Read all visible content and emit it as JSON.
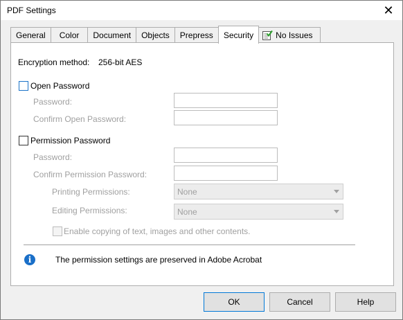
{
  "window": {
    "title": "PDF Settings"
  },
  "tabs": [
    {
      "label": "General"
    },
    {
      "label": "Color"
    },
    {
      "label": "Document"
    },
    {
      "label": "Objects"
    },
    {
      "label": "Prepress"
    },
    {
      "label": "Security"
    },
    {
      "label": "No Issues"
    }
  ],
  "active_tab": "Security",
  "encryption": {
    "label": "Encryption method:",
    "value": "256-bit AES"
  },
  "open_password": {
    "checkbox_label": "Open Password",
    "checked": false,
    "password_label": "Password:",
    "password_value": "",
    "confirm_label": "Confirm Open Password:",
    "confirm_value": ""
  },
  "permission_password": {
    "checkbox_label": "Permission Password",
    "checked": false,
    "password_label": "Password:",
    "password_value": "",
    "confirm_label": "Confirm Permission Password:",
    "confirm_value": "",
    "printing_label": "Printing Permissions:",
    "printing_value": "None",
    "editing_label": "Editing Permissions:",
    "editing_value": "None",
    "copy_label": "Enable copying of text, images and other contents.",
    "copy_checked": false
  },
  "info": {
    "icon": "info-icon",
    "text": "The permission settings are preserved in Adobe Acrobat"
  },
  "buttons": {
    "ok": "OK",
    "cancel": "Cancel",
    "help": "Help"
  },
  "colors": {
    "accent": "#0078d7",
    "info": "#1a6fc8",
    "disabled_text": "#a0a0a0"
  }
}
